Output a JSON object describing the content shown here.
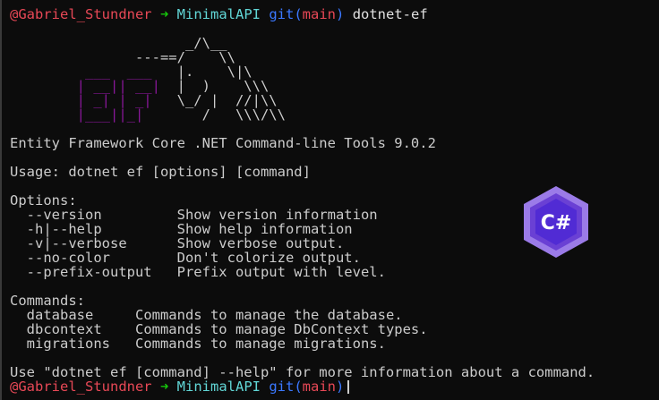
{
  "prompt1": {
    "user": "@Gabriel_Stundner",
    "arrow": "➜",
    "dir": "MinimalAPI",
    "git": "git(",
    "branch": "main",
    "git_close": ")",
    "command": "dotnet-ef"
  },
  "ascii": {
    "l1": "                     _/\\__",
    "l2": "               ---==/    \\\\",
    "l3a": "         ___  ___   ",
    "l3b": "|.    \\|\\",
    "l4a": "        | __|| __|  ",
    "l4b": "|  )    \\\\\\",
    "l5a": "        | _| | _|   ",
    "l5b": "\\_/ |  //|\\\\",
    "l6a": "        |___||_|       ",
    "l6b": "/   \\\\\\/\\\\"
  },
  "header": "Entity Framework Core .NET Command-line Tools 9.0.2",
  "usage": "Usage: dotnet ef [options] [command]",
  "options_title": "Options:",
  "options": [
    {
      "flag": "--version",
      "desc": "Show version information"
    },
    {
      "flag": "-h|--help",
      "desc": "Show help information"
    },
    {
      "flag": "-v|--verbose",
      "desc": "Show verbose output."
    },
    {
      "flag": "--no-color",
      "desc": "Don't colorize output."
    },
    {
      "flag": "--prefix-output",
      "desc": "Prefix output with level."
    }
  ],
  "commands_title": "Commands:",
  "commands": [
    {
      "name": "database",
      "desc": "Commands to manage the database."
    },
    {
      "name": "dbcontext",
      "desc": "Commands to manage DbContext types."
    },
    {
      "name": "migrations",
      "desc": "Commands to manage migrations."
    }
  ],
  "footer": "Use \"dotnet ef [command] --help\" for more information about a command.",
  "prompt2": {
    "user": "@Gabriel_Stundner",
    "arrow": "➜",
    "dir": "MinimalAPI",
    "git": "git(",
    "branch": "main",
    "git_close": ")"
  },
  "logo": {
    "text": "C#",
    "colors": {
      "outer": "#9b7be8",
      "mid": "#6a40d4",
      "inner": "#512bd4"
    }
  }
}
